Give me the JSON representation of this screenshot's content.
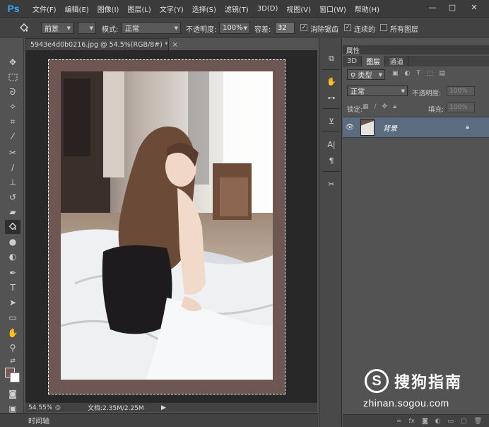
{
  "app": {
    "logo": "Ps"
  },
  "menu": [
    {
      "label": "文件(F)"
    },
    {
      "label": "编辑(E)"
    },
    {
      "label": "图像(I)"
    },
    {
      "label": "图层(L)"
    },
    {
      "label": "文字(Y)"
    },
    {
      "label": "选择(S)"
    },
    {
      "label": "滤镜(T)"
    },
    {
      "label": "3D(D)"
    },
    {
      "label": "视图(V)"
    },
    {
      "label": "窗口(W)"
    },
    {
      "label": "帮助(H)"
    }
  ],
  "window_controls": {
    "minimize": "—",
    "maximize": "□",
    "close": "✕"
  },
  "options": {
    "fill_source": "前景",
    "mode_label": "模式:",
    "mode_value": "正常",
    "opacity_label": "不透明度:",
    "opacity_value": "100%",
    "tolerance_label": "容差:",
    "tolerance_value": "32",
    "antialias_label": "消除锯齿",
    "antialias_checked": true,
    "contiguous_label": "连续的",
    "contiguous_checked": true,
    "all_layers_label": "所有图层",
    "all_layers_checked": false
  },
  "document": {
    "tab_title": "5943e4d0b0216.jpg @ 54.5%(RGB/8#) *",
    "close": "×",
    "zoom": "54.55%",
    "doc_info": "文档:2.35M/2.25M"
  },
  "timeline_label": "时间轴",
  "colors": {
    "foreground": "#7a5954",
    "background": "#ffffff",
    "canvas_border": "#6e5652",
    "selected_layer": "#5b6b80"
  },
  "panels": {
    "properties_title": "属性",
    "tabs": [
      {
        "label": "3D"
      },
      {
        "label": "图层"
      },
      {
        "label": "通道"
      }
    ],
    "filter_type": "类型",
    "blend_mode": "正常",
    "opacity_label": "不透明度:",
    "opacity_value": "100%",
    "lock_label": "锁定:",
    "fill_label": "填充:",
    "fill_value": "100%",
    "layer_name": "背景"
  },
  "watermark": {
    "logo": "S",
    "brand": "搜狗指南",
    "url": "zhinan.sogou.com"
  }
}
